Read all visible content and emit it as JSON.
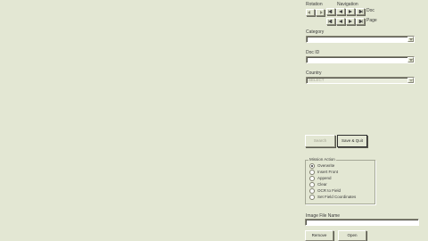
{
  "nav": {
    "rotation_label": "Rotation",
    "navigation_label": "Navigation",
    "doc_label": "Doc",
    "page_label": "Page"
  },
  "category": {
    "label": "Category",
    "value": ""
  },
  "doc_id": {
    "label": "Doc ID",
    "value": ""
  },
  "country": {
    "label": "Country",
    "value": "SELECT"
  },
  "actions": {
    "search_label": "Search",
    "save_quit_label": "Save & Quit"
  },
  "mission_action": {
    "legend": "Mission Action",
    "options": [
      {
        "label": "Overwrite",
        "selected": true
      },
      {
        "label": "Insert Front",
        "selected": false
      },
      {
        "label": "Append",
        "selected": false
      },
      {
        "label": "Clear",
        "selected": false
      },
      {
        "label": "OCR to Field",
        "selected": false
      },
      {
        "label": "Set Field Coordinates",
        "selected": false
      }
    ]
  },
  "image_file": {
    "label": "Image File Name",
    "value": ""
  },
  "footer": {
    "remove_label": "Remove",
    "open_label": "Open"
  },
  "colors": {
    "background": "#e3e7d3",
    "disabled_text": "#a0a090"
  }
}
